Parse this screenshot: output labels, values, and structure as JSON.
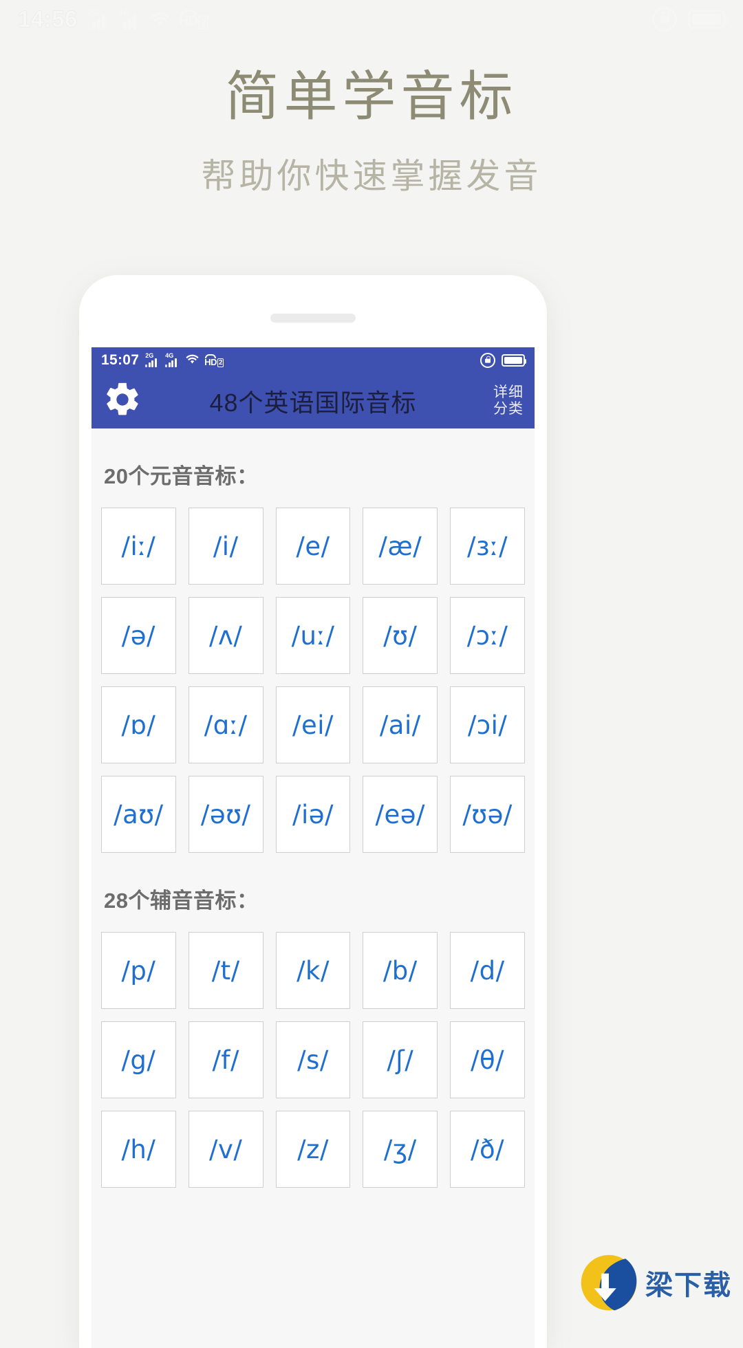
{
  "os_status_bar": {
    "time": "14:56",
    "signal_2g_label": "2G",
    "signal_4g_label": "4G",
    "hd_label": "HD",
    "hd_sim": "2",
    "wifi_icon": "wifi-icon",
    "rotation_lock_icon": "rotation-lock-icon",
    "battery_icon": "battery-icon"
  },
  "hero": {
    "title": "简单学音标",
    "subtitle": "帮助你快速掌握发音",
    "title_color": "#8d8b74",
    "subtitle_color": "#b6b4a5"
  },
  "phone": {
    "speaker": "earpiece-speaker"
  },
  "app_status_bar": {
    "time": "15:07",
    "signal_2g_label": "2G",
    "signal_4g_label": "4G",
    "hd_label": "HD",
    "hd_sim": "2",
    "accent_color": "#3f51b0"
  },
  "app_bar": {
    "gear_icon": "gear-icon",
    "title": "48个英语国际音标",
    "detail_line1": "详细",
    "detail_line2": "分类"
  },
  "content": {
    "vowels_heading": "20个元音音标：",
    "vowels": [
      "/iː/",
      "/i/",
      "/e/",
      "/æ/",
      "/ɜː/",
      "/ə/",
      "/ʌ/",
      "/uː/",
      "/ʊ/",
      "/ɔː/",
      "/ɒ/",
      "/ɑː/",
      "/ei/",
      "/ai/",
      "/ɔi/",
      "/aʊ/",
      "/əʊ/",
      "/iə/",
      "/eə/",
      "/ʊə/"
    ],
    "consonants_heading": "28个辅音音标：",
    "consonants": [
      "/p/",
      "/t/",
      "/k/",
      "/b/",
      "/d/",
      "/g/",
      "/f/",
      "/s/",
      "/ʃ/",
      "/θ/",
      "/h/",
      "/v/",
      "/z/",
      "/ʒ/",
      "/ð/"
    ],
    "symbol_color": "#1f6fd0",
    "heading_color": "#6d6d6d"
  },
  "watermark": {
    "text": "梁下载",
    "logo_icon": "download-logo-icon"
  }
}
